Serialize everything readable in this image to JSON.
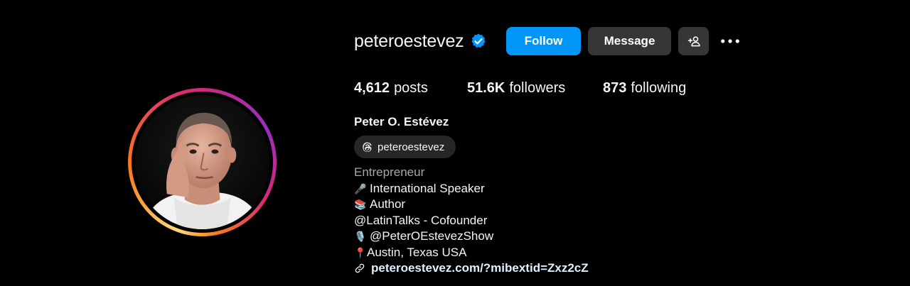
{
  "profile": {
    "username": "peteroestevez",
    "verified": true,
    "full_name": "Peter O. Estévez",
    "threads_handle": "peteroestevez"
  },
  "actions": {
    "follow_label": "Follow",
    "message_label": "Message",
    "add_user_icon": "add-user-icon",
    "more_icon": "more-options-icon"
  },
  "stats": {
    "posts_count": "4,612",
    "posts_label": "posts",
    "followers_count": "51.6K",
    "followers_label": "followers",
    "following_count": "873",
    "following_label": "following"
  },
  "bio": {
    "category": "Entrepreneur",
    "lines": [
      {
        "emoji": "🎤",
        "text": "International Speaker"
      },
      {
        "emoji": "📚",
        "text": "Author"
      },
      {
        "emoji": "",
        "text": "@LatinTalks - Cofounder"
      },
      {
        "emoji": "🎙️",
        "text": "@PeterOEstevezShow"
      },
      {
        "emoji": "📍",
        "text": "Austin, Texas USA"
      }
    ],
    "link": "peteroestevez.com/?mibextid=Zxz2cZ"
  },
  "colors": {
    "background": "#000000",
    "follow_button": "#0095f6",
    "secondary_button": "#363636",
    "verified_badge": "#0095f6",
    "category_text": "#a8a8a8"
  }
}
